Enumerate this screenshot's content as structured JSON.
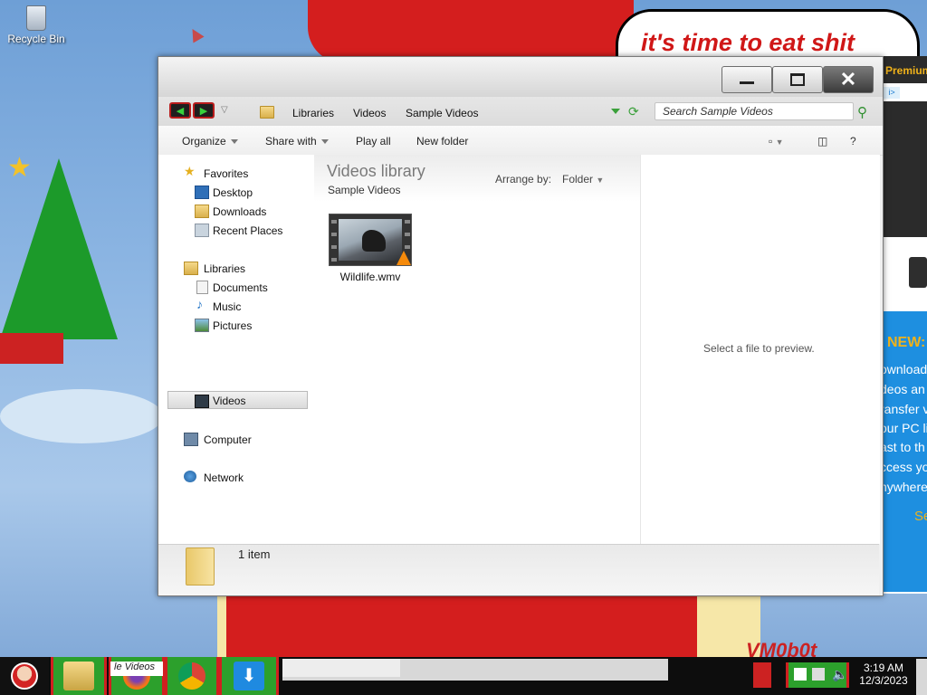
{
  "desktop": {
    "recycle_bin_label": "Recycle Bin",
    "wallpaper_text": "it's time to eat shit",
    "wallpaper_signature": "VM0b0t"
  },
  "browser_behind": {
    "premium_label": "Premium",
    "ad_badge": "i>",
    "new_label": "NEW:",
    "lines": [
      "ownload",
      "deos an",
      "ransfer v",
      "our PC li",
      "ast to th",
      "ccess yo",
      "nywhere"
    ],
    "se_label": "Se"
  },
  "explorer": {
    "window_controls": {
      "minimize_icon": "minimize-icon",
      "maximize_icon": "maximize-icon",
      "close_icon": "close-icon"
    },
    "breadcrumb": [
      "Libraries",
      "Videos",
      "Sample Videos"
    ],
    "search_placeholder": "Search Sample Videos",
    "toolbar": {
      "organize": "Organize",
      "share_with": "Share with",
      "play_all": "Play all",
      "new_folder": "New folder",
      "help": "?"
    },
    "nav": {
      "favorites": "Favorites",
      "desktop": "Desktop",
      "downloads": "Downloads",
      "recent_places": "Recent Places",
      "libraries": "Libraries",
      "documents": "Documents",
      "music": "Music",
      "pictures": "Pictures",
      "videos": "Videos",
      "computer": "Computer",
      "network": "Network"
    },
    "library": {
      "title": "Videos library",
      "subtitle": "Sample Videos",
      "arrange_label": "Arrange by:",
      "arrange_value": "Folder"
    },
    "files": [
      {
        "name": "Wildlife.wmv"
      }
    ],
    "preview_text": "Select a file to preview.",
    "status": {
      "item_count": "1 item"
    }
  },
  "taskbar": {
    "explorer_button_label": "le Videos",
    "clock_time": "3:19 AM",
    "clock_date": "12/3/2023"
  },
  "colors": {
    "taskbar_button_green": "#2ca02c",
    "taskbar_button_border": "#d02020",
    "wallpaper_red": "#d41e1e",
    "browser_blue": "#1e8fe0"
  }
}
